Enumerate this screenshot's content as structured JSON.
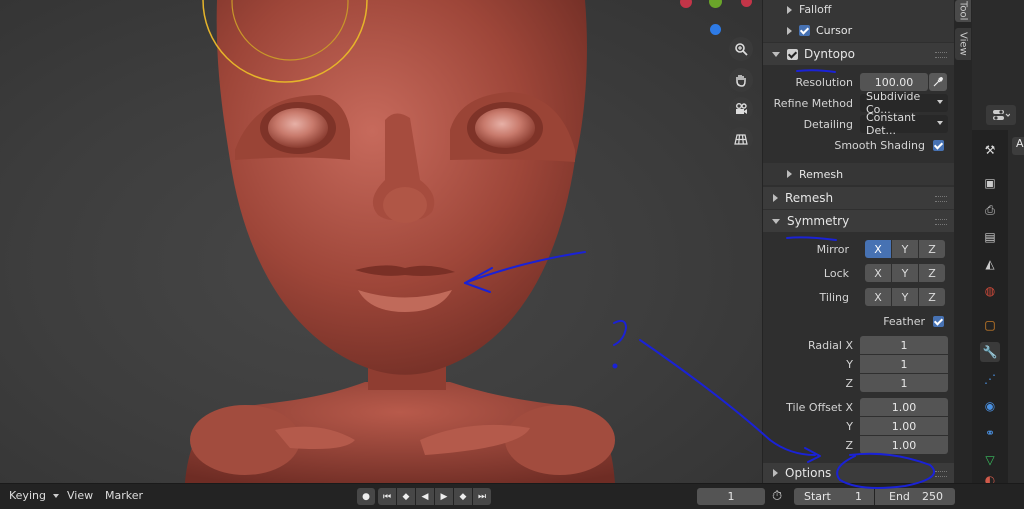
{
  "panel": {
    "falloff_label": "Falloff",
    "cursor_label": "Cursor",
    "dyntopo_label": "Dyntopo",
    "resolution_label": "Resolution",
    "resolution_value": "100.00",
    "refine_method_label": "Refine Method",
    "refine_method_value": "Subdivide Co...",
    "detailing_label": "Detailing",
    "detailing_value": "Constant Det...",
    "smooth_shading_label": "Smooth Shading",
    "remesh_sub_label": "Remesh",
    "remesh_label": "Remesh",
    "symmetry_label": "Symmetry",
    "mirror_label": "Mirror",
    "lock_label": "Lock",
    "tiling_label": "Tiling",
    "axis_x": "X",
    "axis_y": "Y",
    "axis_z": "Z",
    "feather_label": "Feather",
    "radial_x_label": "Radial X",
    "radial_y_label": "Y",
    "radial_z_label": "Z",
    "radial_x": "1",
    "radial_y": "1",
    "radial_z": "1",
    "tile_offset_x_label": "Tile Offset X",
    "tile_offset_y_label": "Y",
    "tile_offset_z_label": "Z",
    "tile_offset_x": "1.00",
    "tile_offset_y": "1.00",
    "tile_offset_z": "1.00",
    "options_label": "Options"
  },
  "tabs": {
    "tool": "Tool",
    "view": "View"
  },
  "props_partial_label": "A",
  "timeline": {
    "keying_label": "Keying",
    "view_label": "View",
    "marker_label": "Marker",
    "current_frame": "1",
    "start_label": "Start",
    "start_value": "1",
    "end_label": "End",
    "end_value": "250"
  },
  "icons": {
    "zoom": "magnifier-icon",
    "pan": "hand-icon",
    "camera": "camera-icon",
    "grid": "grid-icon"
  },
  "colors": {
    "accent": "#4772b3",
    "model": "#9a4538",
    "annotation": "#1a22d6",
    "brush_circle": "#e0b020"
  }
}
